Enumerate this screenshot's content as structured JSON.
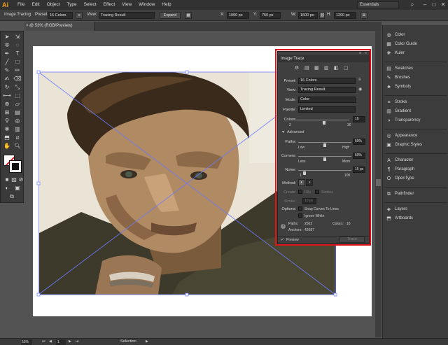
{
  "app": {
    "logo": "Ai"
  },
  "menu": [
    "File",
    "Edit",
    "Object",
    "Type",
    "Select",
    "Effect",
    "View",
    "Window",
    "Help"
  ],
  "workspace": "Essentials",
  "control_bar": {
    "mode_label": "Image Tracing",
    "preset_label": "Preset:",
    "preset_value": "16 Colors",
    "view_label": "View:",
    "view_value": "Tracing Result",
    "expand_label": "Expand",
    "x_label": "X:",
    "x_value": "1000 px",
    "y_label": "Y:",
    "y_value": "750 px",
    "w_label": "W:",
    "w_value": "1600 px",
    "h_label": "H:",
    "h_value": "1200 px"
  },
  "document_tab": "@ 53% (RGB/Preview)",
  "status": {
    "zoom": "53%",
    "page": "1",
    "tool": "Selection"
  },
  "right_panels": [
    {
      "icon": "color-icon",
      "label": "Color"
    },
    {
      "icon": "color-guide-icon",
      "label": "Color Guide"
    },
    {
      "icon": "kuler-icon",
      "label": "Kuler"
    },
    {
      "icon": "swatches-icon",
      "label": "Swatches"
    },
    {
      "icon": "brushes-icon",
      "label": "Brushes"
    },
    {
      "icon": "symbols-icon",
      "label": "Symbols"
    },
    {
      "icon": "stroke-icon",
      "label": "Stroke"
    },
    {
      "icon": "gradient-icon",
      "label": "Gradient"
    },
    {
      "icon": "transparency-icon",
      "label": "Transparency"
    },
    {
      "icon": "appearance-icon",
      "label": "Appearance"
    },
    {
      "icon": "graphic-styles-icon",
      "label": "Graphic Styles"
    },
    {
      "icon": "character-icon",
      "label": "Character"
    },
    {
      "icon": "paragraph-icon",
      "label": "Paragraph"
    },
    {
      "icon": "opentype-icon",
      "label": "OpenType"
    },
    {
      "icon": "pathfinder-icon",
      "label": "Pathfinder"
    },
    {
      "icon": "layers-icon",
      "label": "Layers"
    },
    {
      "icon": "artboards-icon",
      "label": "Artboards"
    }
  ],
  "image_trace": {
    "title": "Image Trace",
    "preset_label": "Preset:",
    "preset_value": "16 Colors",
    "view_label": "View:",
    "view_value": "Tracing Result",
    "mode_label": "Mode:",
    "mode_value": "Color",
    "palette_label": "Palette:",
    "palette_value": "Limited",
    "colors_label": "Colors:",
    "colors_value": "16",
    "colors_min": "2",
    "colors_max": "30",
    "advanced_label": "Advanced",
    "paths_label": "Paths:",
    "paths_value": "50%",
    "paths_low": "Low",
    "paths_high": "High",
    "corners_label": "Corners:",
    "corners_value": "50%",
    "corners_less": "Less",
    "corners_more": "More",
    "noise_label": "Noise:",
    "noise_value": "15 px",
    "noise_min": "1",
    "noise_max": "100",
    "method_label": "Method:",
    "create_label": "Create:",
    "fills_label": "Fills",
    "strokes_label": "Strokes",
    "stroke_label": "Stroke:",
    "stroke_value": "10 px",
    "options_label": "Options:",
    "snap_label": "Snap Curves To Lines",
    "ignore_white_label": "Ignore White",
    "paths_stat_label": "Paths:",
    "paths_stat_value": "2502",
    "colors_stat_label": "Colors:",
    "colors_stat_value": "16",
    "anchors_stat_label": "Anchors:",
    "anchors_stat_value": "42687",
    "preview_label": "Preview",
    "trace_label": "Trace"
  }
}
